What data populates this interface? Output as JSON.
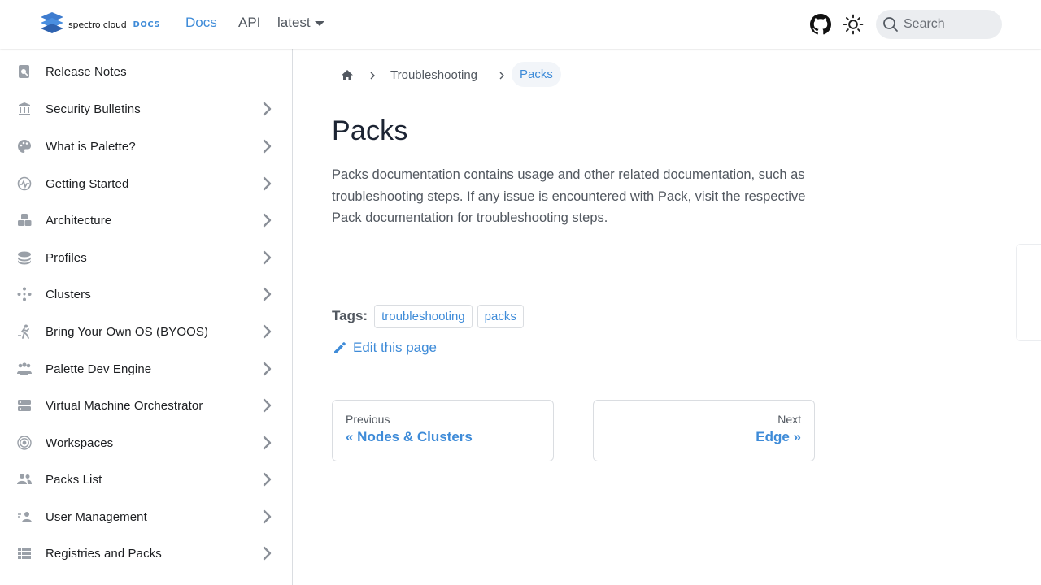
{
  "navbar": {
    "brand": "spectro cloud",
    "brand_suffix": "DOCS",
    "links": {
      "docs": "Docs",
      "api": "API",
      "version": "latest"
    },
    "search_placeholder": "Search",
    "accent_color": "#3e8bd8"
  },
  "sidebar": {
    "items": [
      {
        "label": "Release Notes",
        "icon": "release-notes-icon",
        "expandable": false
      },
      {
        "label": "Security Bulletins",
        "icon": "security-icon",
        "expandable": true
      },
      {
        "label": "What is Palette?",
        "icon": "palette-icon",
        "expandable": true
      },
      {
        "label": "Getting Started",
        "icon": "getting-started-icon",
        "expandable": true
      },
      {
        "label": "Architecture",
        "icon": "architecture-icon",
        "expandable": true
      },
      {
        "label": "Profiles",
        "icon": "profiles-icon",
        "expandable": true
      },
      {
        "label": "Clusters",
        "icon": "clusters-icon",
        "expandable": true
      },
      {
        "label": "Bring Your Own OS (BYOOS)",
        "icon": "byoos-icon",
        "expandable": true
      },
      {
        "label": "Palette Dev Engine",
        "icon": "dev-engine-icon",
        "expandable": true
      },
      {
        "label": "Virtual Machine Orchestrator",
        "icon": "vmo-icon",
        "expandable": true
      },
      {
        "label": "Workspaces",
        "icon": "workspaces-icon",
        "expandable": true
      },
      {
        "label": "Packs List",
        "icon": "packs-list-icon",
        "expandable": true
      },
      {
        "label": "User Management",
        "icon": "user-management-icon",
        "expandable": true
      },
      {
        "label": "Registries and Packs",
        "icon": "registries-icon",
        "expandable": true
      }
    ]
  },
  "breadcrumbs": {
    "items": [
      "Troubleshooting",
      "Packs"
    ]
  },
  "content": {
    "title": "Packs",
    "description": "Packs documentation contains usage and other related documentation, such as troubleshooting steps. If any issue is encountered with Pack, visit the respective Pack documentation for troubleshooting steps.",
    "tags_label": "Tags:",
    "tags": [
      "troubleshooting",
      "packs"
    ],
    "edit_label": "Edit this page"
  },
  "pagination": {
    "prev": {
      "sub": "Previous",
      "title": "« Nodes & Clusters"
    },
    "next": {
      "sub": "Next",
      "title": "Edge »"
    }
  }
}
